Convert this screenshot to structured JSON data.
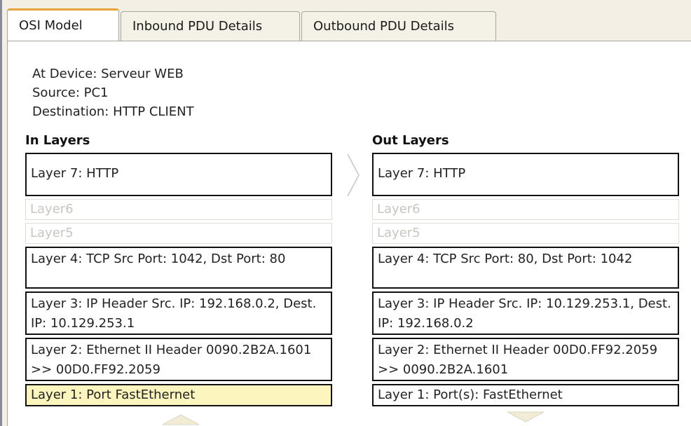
{
  "tabs": [
    {
      "label": "OSI Model"
    },
    {
      "label": "Inbound PDU Details"
    },
    {
      "label": "Outbound PDU Details"
    }
  ],
  "info": {
    "at_device": "At Device: Serveur WEB",
    "source": "Source: PC1",
    "destination": "Destination: HTTP CLIENT"
  },
  "in_layers": {
    "heading": "In Layers",
    "layers": [
      "Layer 7: HTTP",
      "Layer6",
      "Layer5",
      "Layer 4: TCP Src Port: 1042, Dst Port: 80",
      "Layer 3: IP Header Src. IP: 192.168.0.2, Dest. IP: 10.129.253.1",
      "Layer 2: Ethernet II Header 0090.2B2A.1601 >> 00D0.FF92.2059",
      "Layer 1: Port FastEthernet"
    ]
  },
  "out_layers": {
    "heading": "Out Layers",
    "layers": [
      "Layer 7: HTTP",
      "Layer6",
      "Layer5",
      "Layer 4: TCP Src Port: 80, Dst Port: 1042",
      "Layer 3: IP Header Src. IP: 10.129.253.1, Dest. IP: 192.168.0.2",
      "Layer 2: Ethernet II Header 00D0.FF92.2059 >> 0090.2B2A.1601",
      "Layer 1: Port(s): FastEthernet"
    ]
  },
  "icons": {
    "flow_arrow": "chevron-right-icon",
    "scroll_up": "chevron-up-icon",
    "scroll_down": "chevron-down-icon"
  },
  "colors": {
    "active_tab_accent": "#e8a23c",
    "selected_layer": "#fcf6be"
  }
}
